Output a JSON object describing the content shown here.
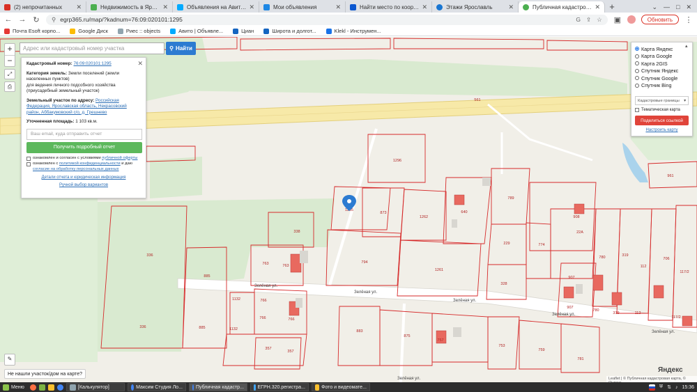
{
  "tabs": [
    {
      "label": "(2) непрочитанных",
      "color": "#d93025"
    },
    {
      "label": "Недвижимость в Ярославле",
      "color": "#4caf50"
    },
    {
      "label": "Объявления на Авито Pro",
      "color": "#00aaff"
    },
    {
      "label": "Мои объявления",
      "color": "#1e88e5"
    },
    {
      "label": "Найти место по координатам",
      "color": "#0b57d0"
    },
    {
      "label": "Этажи Ярославль",
      "color": "#1976d2"
    },
    {
      "label": "Публичная кадастровая карта",
      "color": "#4caf50"
    }
  ],
  "browser": {
    "url": "egrp365.ru/map/?kadnum=76:09:020101:1295",
    "update_label": "Обновить"
  },
  "bookmarks": [
    {
      "label": "Почта Esoft корпо...",
      "color": "#e53935"
    },
    {
      "label": "Google Диск",
      "color": "#fbbc04"
    },
    {
      "label": "Риес :: objects",
      "color": "#90a4ae"
    },
    {
      "label": "Авито | Объявле...",
      "color": "#00aaff"
    },
    {
      "label": "Циан",
      "color": "#1565c0"
    },
    {
      "label": "Широта и долгот...",
      "color": "#1565c0"
    },
    {
      "label": "Klekl - Инструмен...",
      "color": "#1a73e8"
    }
  ],
  "search": {
    "placeholder": "Адрес или кадастровый номер участка",
    "button": "Найти"
  },
  "info": {
    "cad_label": "Кадастровый номер:",
    "cad_value": "76:09:020101:1295",
    "category_label": "Категория земель:",
    "category_value": "Земли поселений (земли населенных пунктов)",
    "use_value": "для ведения личного подсобного хозяйства (приусадебный земельный участок)",
    "address_label": "Земельный участок по адресу:",
    "address_value": "Российская Федерация, Ярославская область, Некрасовский район, Аббакумовский с/о, д. Грешнево",
    "area_label": "Уточненная площадь:",
    "area_value": "1 103 кв.м.",
    "email_placeholder": "Ваш email, куда отправить отчет",
    "report_button": "Получить подробный отчет",
    "agree1_text": "ознакомлен и согласен с условиями",
    "agree1_link": "публичной оферты",
    "agree2_text": "ознакомлен с",
    "agree2_link": "политикой конфиденциальности",
    "agree2_tail": "и даю",
    "agree2_link2": "согласие на обработку персональных данных",
    "details_link": "Детали отчета и юридическая информация",
    "manual_link": "Ручной выбор вариантов"
  },
  "layers": {
    "options": [
      "Карта Яндекс",
      "Карта Google",
      "Карта 2GIS",
      "Спутник Яндекс",
      "Спутник Google",
      "Спутник Bing"
    ],
    "selected": 0,
    "select_value": "Кадастровые границы",
    "thematic_label": "Тематическая карта",
    "share_button": "Поделиться ссылкой",
    "config_link": "Настроить карту"
  },
  "map": {
    "parcels": [
      "1296",
      "336",
      "336",
      "885",
      "885",
      "338",
      "763",
      "763",
      "1295",
      "873",
      "1262",
      "640",
      "789",
      "908",
      "22А",
      "794",
      "1261",
      "229",
      "774",
      "780",
      "319",
      "112",
      "706",
      "117/2",
      "328",
      "907",
      "907",
      "780",
      "319",
      "112",
      "117/2",
      "1132",
      "766",
      "766",
      "1132",
      "766",
      "883",
      "875",
      "757",
      "753",
      "759",
      "781",
      "357",
      "357",
      "961",
      "561"
    ],
    "streets": [
      "Зелёная ул.",
      "Зелёная ул.",
      "Зелёная ул.",
      "Зелёная ул.",
      "Зелёная ул.",
      "Зелёная ул."
    ],
    "selected_parcel": "1295",
    "not_found": "Не нашли участок/дом на карте?",
    "provider": "Яндекс",
    "attribution": "Leaflet | © Публичная кадастровая карта, © Яндекс"
  },
  "taskbar": {
    "menu": "Меню",
    "windows": [
      "[Калькулятор]",
      "Максим Студия Ло...",
      "Публичная кадастр...",
      "ЕГРН.320.регистра...",
      "Фото и видеомате..."
    ],
    "active_window": 2,
    "clock": "15:36"
  }
}
